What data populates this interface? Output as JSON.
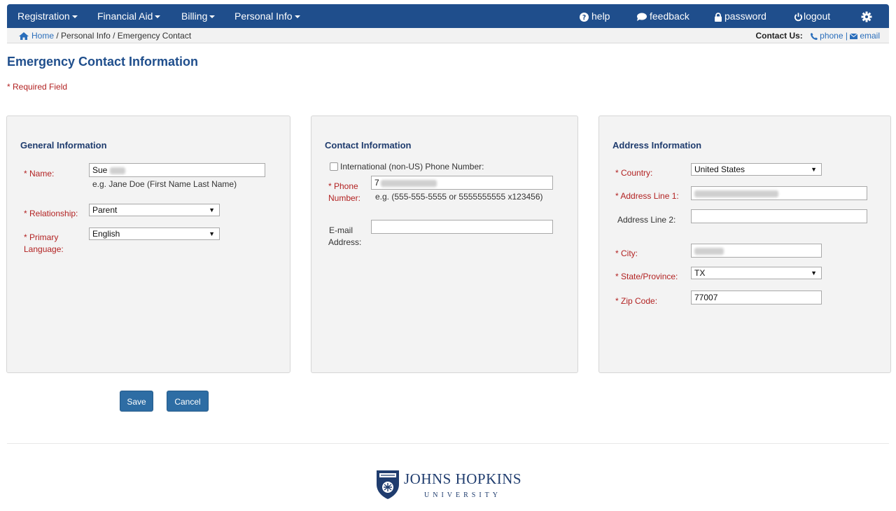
{
  "nav": {
    "registration": "Registration",
    "financial_aid": "Financial Aid",
    "billing": "Billing",
    "personal_info": "Personal Info",
    "help": "help",
    "feedback": "feedback",
    "password": "password",
    "logout": "logout"
  },
  "breadcrumb": {
    "home": "Home",
    "sep1": " / ",
    "personal_info": "Personal Info",
    "sep2": " / ",
    "current": "Emergency Contact"
  },
  "contact": {
    "label": "Contact Us:",
    "phone": "phone",
    "sep": " | ",
    "email": "email"
  },
  "page": {
    "title": "Emergency Contact Information",
    "required_note": "* Required Field"
  },
  "general": {
    "title": "General Information",
    "name_label": "* Name:",
    "name_value": "Sue",
    "name_hint": "e.g. Jane Doe (First Name Last Name)",
    "relationship_label": "* Relationship:",
    "relationship_value": "Parent",
    "language_label_1": "* Primary",
    "language_label_2": "Language:",
    "language_value": "English"
  },
  "contact_info": {
    "title": "Contact Information",
    "international_label": "International (non-US) Phone Number:",
    "phone_label_1": "* Phone",
    "phone_label_2": "Number:",
    "phone_value": "7",
    "phone_hint": "e.g. (555-555-5555 or 5555555555 x123456)",
    "email_label_1": "E-mail",
    "email_label_2": "Address:",
    "email_value": ""
  },
  "address": {
    "title": "Address Information",
    "country_label": "* Country:",
    "country_value": "United States",
    "line1_label": "* Address Line 1:",
    "line2_label": "Address Line 2:",
    "city_label": "* City:",
    "state_label": "* State/Province:",
    "state_value": "TX",
    "zip_label": "* Zip Code:",
    "zip_value": "77007"
  },
  "buttons": {
    "save": "Save",
    "cancel": "Cancel"
  },
  "footer": {
    "logo_name": "JOHNS HOPKINS",
    "logo_sub": "UNIVERSITY"
  }
}
